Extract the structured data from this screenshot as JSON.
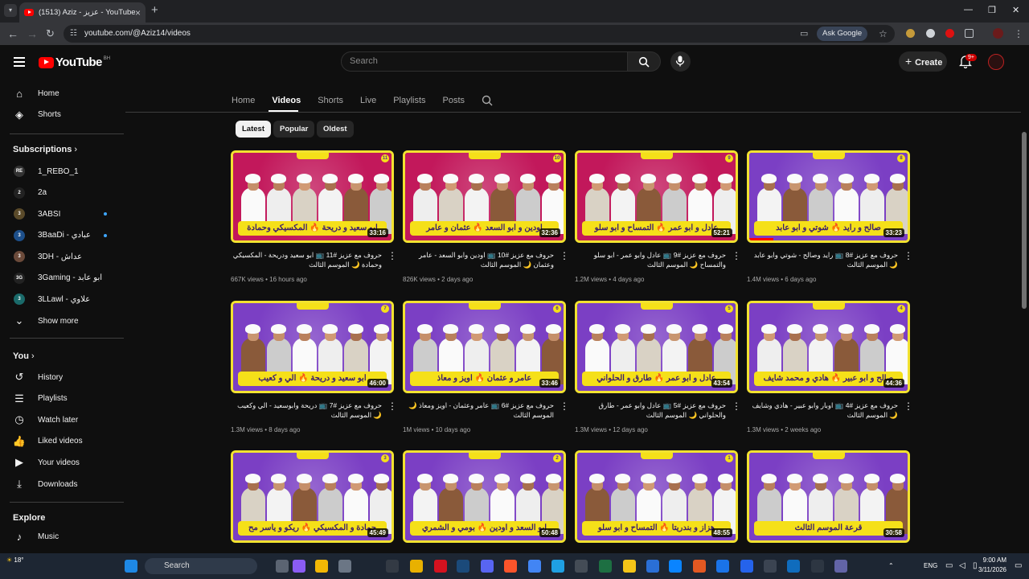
{
  "browser": {
    "tab_title": "(1513) Aziz - عزيز - YouTube",
    "url": "youtube.com/@Aziz14/videos",
    "ask_google": "Ask Google"
  },
  "header": {
    "logo_text": "YouTube",
    "country_code": "BH",
    "search_placeholder": "Search",
    "create_label": "Create",
    "notif_count": "9+"
  },
  "sidebar": {
    "main": [
      {
        "label": "Home",
        "icon": "home-icon"
      },
      {
        "label": "Shorts",
        "icon": "shorts-icon"
      }
    ],
    "subscriptions_title": "Subscriptions",
    "subscriptions": [
      {
        "label": "1_REBO_1",
        "color": "#333333",
        "initial": "REBO",
        "dot": false
      },
      {
        "label": "2a",
        "color": "#222222",
        "initial": "2",
        "dot": false
      },
      {
        "label": "3ABSI",
        "color": "#5a4a2a",
        "initial": "3",
        "dot": true
      },
      {
        "label": "3BaaDi - عبادي",
        "color": "#1d4f8a",
        "initial": "3",
        "dot": true
      },
      {
        "label": "3DH - عداش",
        "color": "#6b4a3a",
        "initial": "3",
        "dot": false
      },
      {
        "label": "3Gaming - ابو عابد",
        "color": "#222222",
        "initial": "3G",
        "dot": false
      },
      {
        "label": "3LLawl - علاوي",
        "color": "#1a6a6a",
        "initial": "3",
        "dot": false
      }
    ],
    "show_more": "Show more",
    "you_title": "You",
    "you_items": [
      {
        "label": "History",
        "icon": "history-icon"
      },
      {
        "label": "Playlists",
        "icon": "playlists-icon"
      },
      {
        "label": "Watch later",
        "icon": "watch-later-icon"
      },
      {
        "label": "Liked videos",
        "icon": "like-icon"
      },
      {
        "label": "Your videos",
        "icon": "your-videos-icon"
      },
      {
        "label": "Downloads",
        "icon": "download-icon"
      }
    ],
    "explore_title": "Explore",
    "explore_items": [
      {
        "label": "Music",
        "icon": "music-icon"
      }
    ]
  },
  "channel_tabs": [
    "Home",
    "Videos",
    "Shorts",
    "Live",
    "Playlists",
    "Posts"
  ],
  "active_tab": "Videos",
  "filters": [
    "Latest",
    "Popular",
    "Oldest"
  ],
  "active_filter": "Latest",
  "videos": [
    {
      "title": "حروف مع عزيز #11 📺 ابو سعيد ودريحة - المكسيكي وحمادة 🌙 الموسم الثالث",
      "views": "667K views",
      "age": "16 hours ago",
      "duration": "33:16",
      "banner": "ابو سعيد و دريحة 🔥 المكسيكي وحمادة",
      "ep": "11",
      "bg": "#c2185b",
      "progress": 0
    },
    {
      "title": "حروف مع عزيز #10 📺 اودين وابو السعد - عامر وعثمان 🌙 الموسم الثالث",
      "views": "826K views",
      "age": "2 days ago",
      "duration": "32:36",
      "banner": "اودين و ابو السعد 🔥 عثمان و عامر",
      "ep": "10",
      "bg": "#c2185b",
      "progress": 0
    },
    {
      "title": "حروف مع عزيز #9 📺 عادل وابو عمر - ابو سلو والتمساح 🌙 الموسم الثالث",
      "views": "1.2M views",
      "age": "4 days ago",
      "duration": "52:21",
      "banner": "عادل و ابو عمر 🔥 التمساح و ابو سلو",
      "ep": "9",
      "bg": "#c2185b",
      "progress": 0
    },
    {
      "title": "حروف مع عزيز #8 📺 رايد وصالح - شوتي وابو عابد 🌙 الموسم الثالث",
      "views": "1.4M views",
      "age": "6 days ago",
      "duration": "33:23",
      "banner": "صالح و رايد 🔥 شوتي و ابو عابد",
      "ep": "8",
      "bg": "#7b3fc4",
      "progress": 0.15
    },
    {
      "title": "حروف مع عزيز #7 📺 دريحة وابوسعيد - الي وكعيب 🌙 الموسم الثالث",
      "views": "1.3M views",
      "age": "8 days ago",
      "duration": "46:00",
      "banner": "ابو سعيد و دريحة 🔥 الي و كعيب",
      "ep": "7",
      "bg": "#7b3fc4",
      "progress": 0
    },
    {
      "title": "حروف مع عزيز #6 📺 عامر وعثمان - اويز ومعاذ 🌙 الموسم الثالث",
      "views": "1M views",
      "age": "10 days ago",
      "duration": "33:46",
      "banner": "عامر و عثمان 🔥 اويز و معاذ",
      "ep": "6",
      "bg": "#7b3fc4",
      "progress": 0
    },
    {
      "title": "حروف مع عزيز #5 📺 عادل وابو عمر - طارق والحلواني 🌙 الموسم الثالث",
      "views": "1.3M views",
      "age": "12 days ago",
      "duration": "43:54",
      "banner": "عادل و ابو عمر 🔥 طارق و الحلواني",
      "ep": "5",
      "bg": "#7b3fc4",
      "progress": 0
    },
    {
      "title": "حروف مع عزيز #4 📺 اوبار وابو عبير - هادي وشايف 🌙 الموسم الثالث",
      "views": "1.3M views",
      "age": "2 weeks ago",
      "duration": "44:36",
      "banner": "صالح و ابو عبير 🔥 هادي و محمد شايف",
      "ep": "4",
      "bg": "#7b3fc4",
      "progress": 0
    },
    {
      "title": "",
      "views": "",
      "age": "",
      "duration": "45:49",
      "banner": "حمادة و المكسيكي 🔥 ريكو و ياسر مح",
      "ep": "3",
      "bg": "#7b3fc4",
      "progress": 0
    },
    {
      "title": "",
      "views": "",
      "age": "",
      "duration": "50:48",
      "banner": "ابو السعد و اودين 🔥 بومي و الشمري",
      "ep": "2",
      "bg": "#7b3fc4",
      "progress": 0
    },
    {
      "title": "",
      "views": "",
      "age": "",
      "duration": "48:55",
      "banner": "هزاز و بندريتا 🔥 التمساح و ابو سلو",
      "ep": "1",
      "bg": "#7b3fc4",
      "progress": 0
    },
    {
      "title": "",
      "views": "",
      "age": "",
      "duration": "30:58",
      "banner": "قرعة الموسم الثالث",
      "ep": "",
      "bg": "#7b3fc4",
      "progress": 0
    }
  ],
  "taskbar": {
    "search_label": "Search",
    "temp": "18°",
    "lang": "ENG",
    "time": "9:00 AM",
    "date": "3/11/2026"
  }
}
